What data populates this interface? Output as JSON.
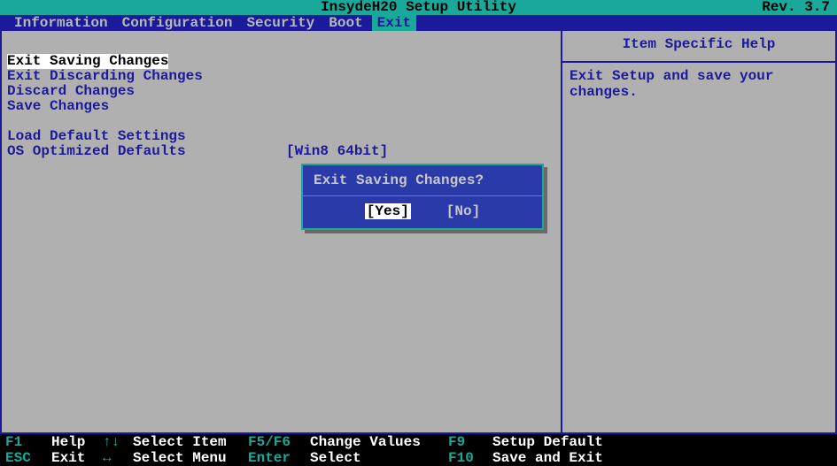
{
  "header": {
    "title": "InsydeH20 Setup Utility",
    "rev": "Rev. 3.7"
  },
  "menubar": {
    "items": [
      "Information",
      "Configuration",
      "Security",
      "Boot",
      "Exit"
    ],
    "active_index": 4
  },
  "exit_menu": {
    "items": [
      "Exit Saving Changes",
      "Exit Discarding Changes",
      "Discard Changes",
      "Save Changes"
    ],
    "selected_index": 0,
    "items2": [
      {
        "label": "Load Default Settings",
        "value": ""
      },
      {
        "label": "OS Optimized Defaults",
        "value": "[Win8 64bit]"
      }
    ]
  },
  "help": {
    "title": "Item Specific Help",
    "body": "Exit Setup and save your changes."
  },
  "dialog": {
    "title": "Exit Saving Changes?",
    "yes": "[Yes]",
    "no": "[No]"
  },
  "footer": {
    "row1": {
      "k1": "F1",
      "l1": "Help",
      "a1": "↑↓",
      "act1": "Select Item",
      "k2": "F5/F6",
      "act2": "Change Values",
      "k3": "F9",
      "act3": "Setup Default"
    },
    "row2": {
      "k1": "ESC",
      "l1": "Exit",
      "a1": "↔",
      "act1": "Select Menu",
      "k2": "Enter",
      "act2": "Select",
      "k3": "F10",
      "act3": "Save and Exit"
    }
  }
}
